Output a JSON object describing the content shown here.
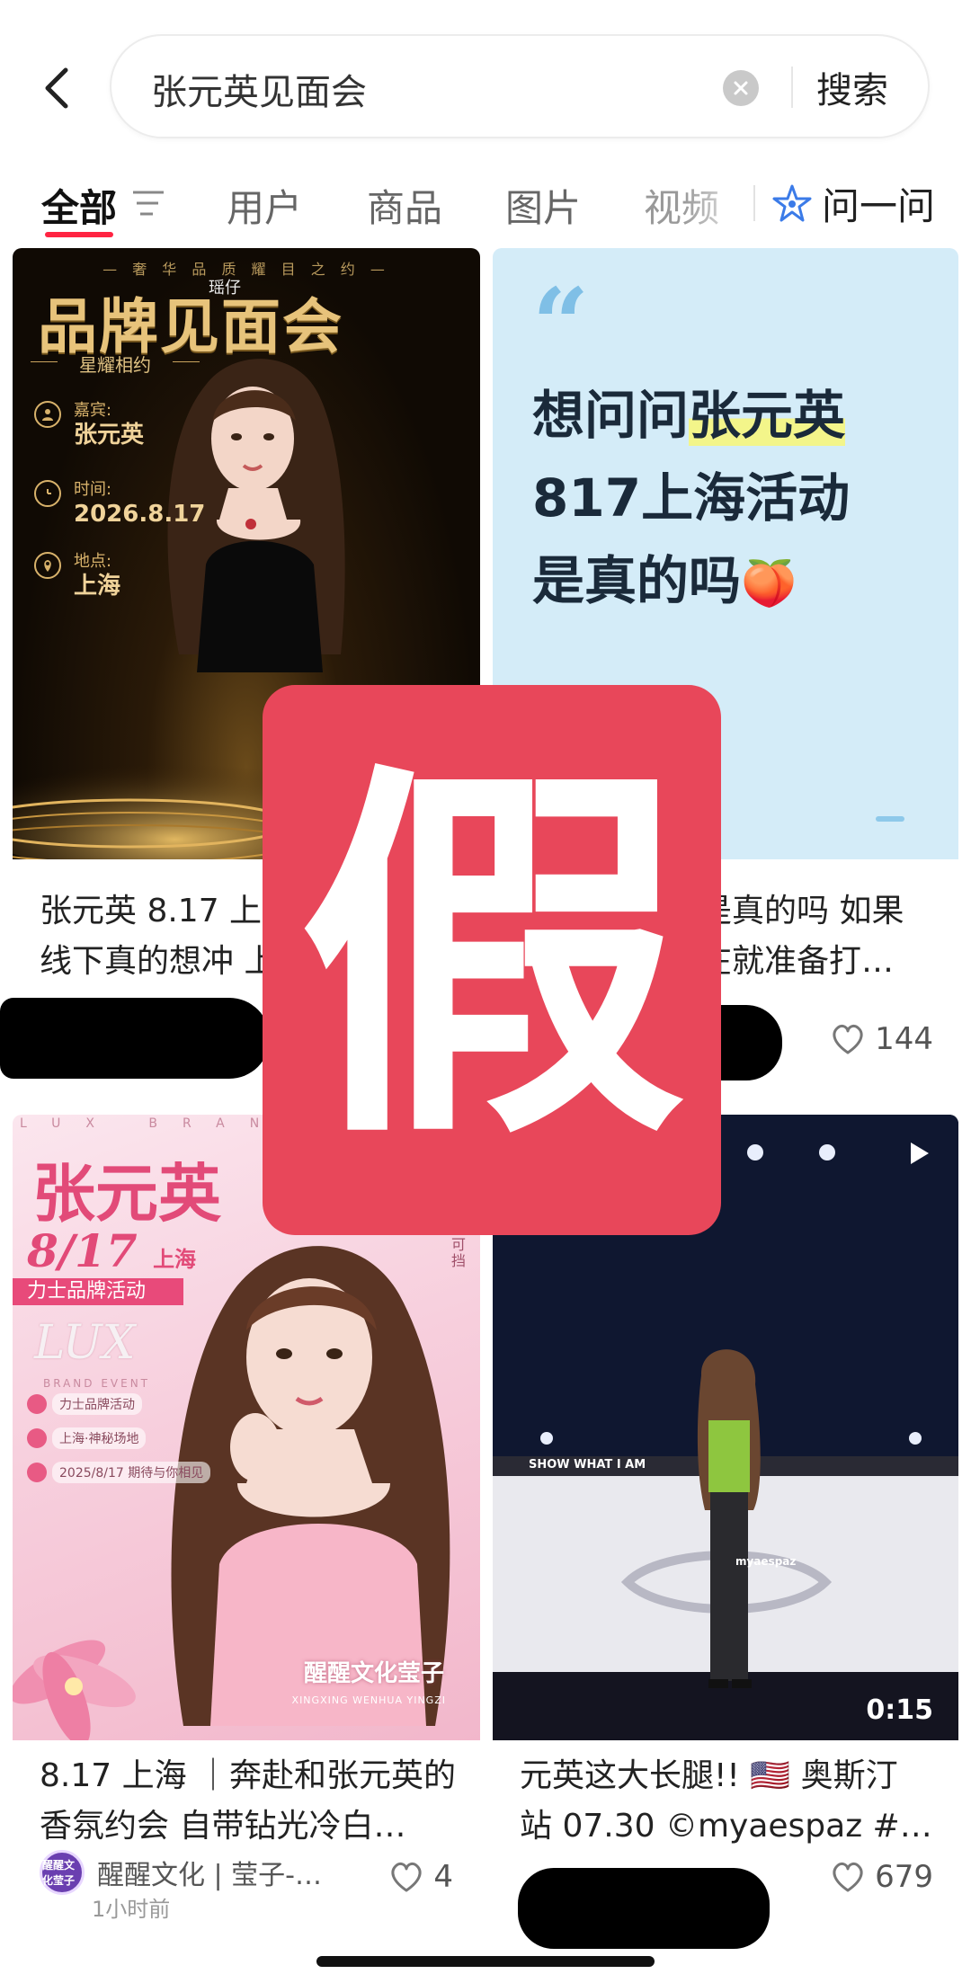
{
  "search": {
    "query": "张元英见面会",
    "button_label": "搜索"
  },
  "tabs": [
    {
      "label": "全部"
    },
    {
      "label": "用户"
    },
    {
      "label": "商品"
    },
    {
      "label": "图片"
    },
    {
      "label": "视频"
    }
  ],
  "ask": {
    "label": "问一问"
  },
  "cards": {
    "a": {
      "poster": {
        "tagline": "— 奢 华 品 质   耀 目 之 约 —",
        "watermark": "瑶仔",
        "title": "品牌见面会",
        "subtitle": "星耀相约",
        "guest_label": "嘉宾:",
        "guest_value": "张元英",
        "time_label": "时间:",
        "time_value": "2026.8.17",
        "place_label": "地点:",
        "place_value": "上海"
      },
      "title_line1": "张元英 8.17 上海",
      "title_line2": "线下真的想冲 上"
    },
    "b": {
      "poster": {
        "line1_pre": "想问问",
        "line1_hl": "张元英",
        "line2": "817上海活动",
        "line3": "是真的吗",
        "emoji": "🍑"
      },
      "title_line1": "是真的吗 如果",
      "title_line2": "在就准备打…",
      "likes": "144"
    },
    "c": {
      "poster": {
        "top_band": "LUX BRAND",
        "name": "张元英",
        "date": "8/17",
        "date_city": "上海",
        "event_bar": "力士品牌活动",
        "script": "LUX",
        "script_sub": "BRAND EVENT",
        "item1": "力士品牌活动",
        "item2": "上海·神秘场地",
        "item3": "2025/8/17 期待与你相见",
        "vertical": "美不可挡",
        "brand": "醒醒文化莹子",
        "brand_sub": "XINGXING WENHUA YINGZI"
      },
      "title_line1": "8.17 上海 ｜奔赴和张元英的",
      "title_line2": "香氛约会 自带钻光冷白…",
      "author": "醒醒文化 | 莹子-…",
      "avatar_text": "醒醒文化莹子",
      "time": "1小时前",
      "likes": "4"
    },
    "d": {
      "poster": {
        "watermark": "myaespaz",
        "duration": "0:15",
        "banner": "SHOW WHAT I AM"
      },
      "title_line1": "元英这大长腿!! 🇺🇸 奥斯汀",
      "title_line2": "站 07.30 ©myaespaz #…",
      "likes": "679"
    }
  },
  "stamp": {
    "text": "假"
  },
  "colors": {
    "accent": "#ff2442",
    "stamp": "#e8475a",
    "card_b_bg": "#d4ecf8"
  }
}
